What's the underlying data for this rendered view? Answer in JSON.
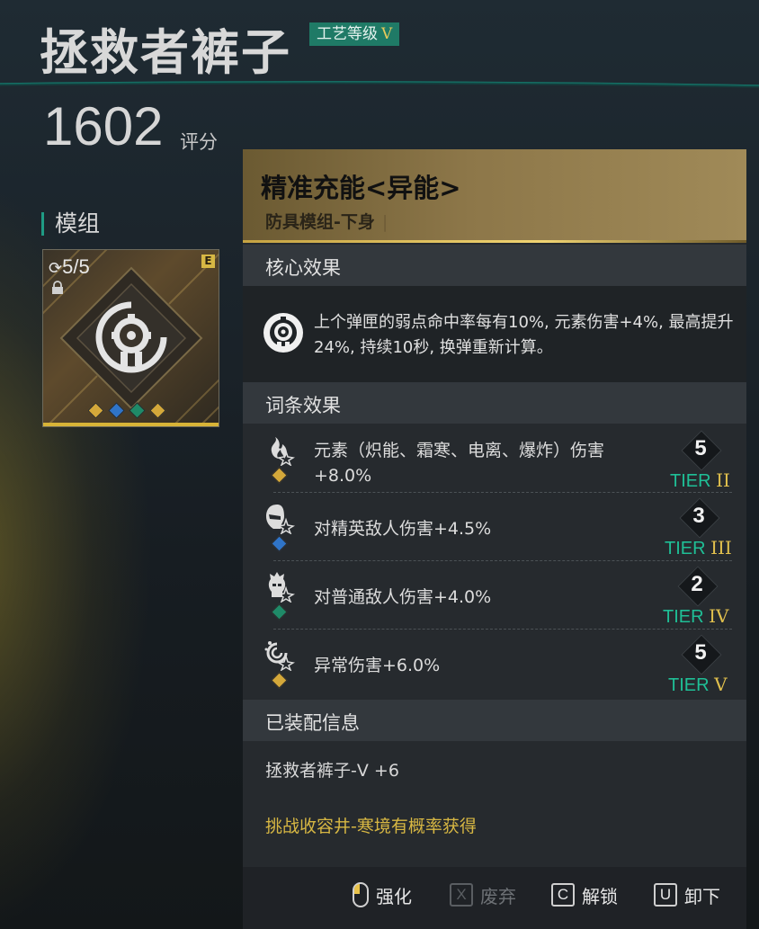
{
  "item": {
    "name": "拯救者裤子",
    "craft_level_label": "工艺等级",
    "craft_level_value": "V",
    "score_value": "1602",
    "score_label": "评分"
  },
  "module": {
    "header": "模组",
    "count": "5/5",
    "grade": "E",
    "gems": [
      "#d4a83a",
      "#2f74c8",
      "#1f8a68",
      "#d4a83a"
    ]
  },
  "panel": {
    "title": "精准充能<异能>",
    "subtitle": "防具模组-下身",
    "core_section": "核心效果",
    "core_text": "上个弹匣的弱点命中率每有10%, 元素伤害+4%, 最高提升24%, 持续10秒, 换弹重新计算。",
    "affix_section": "词条效果",
    "affixes": [
      {
        "text": "元素（炽能、霜寒、电离、爆炸）伤害+8.0%",
        "icon": "flame-burst-icon",
        "gem_color": "#d4a83a",
        "tier_number": "5",
        "tier_prefix": "TIER",
        "tier_roman": "II"
      },
      {
        "text": "对精英敌人伤害+4.5%",
        "icon": "elite-head-icon",
        "gem_color": "#2f74c8",
        "tier_number": "3",
        "tier_prefix": "TIER",
        "tier_roman": "III"
      },
      {
        "text": "对普通敌人伤害+4.0%",
        "icon": "normal-enemy-icon",
        "gem_color": "#1f8a68",
        "tier_number": "2",
        "tier_prefix": "TIER",
        "tier_roman": "IV"
      },
      {
        "text": "异常伤害+6.0%",
        "icon": "anomaly-swirl-icon",
        "gem_color": "#d4a83a",
        "tier_number": "5",
        "tier_prefix": "TIER",
        "tier_roman": "V"
      }
    ],
    "equip_section": "已装配信息",
    "equip_name": "拯救者裤子-V +6",
    "source_text": "挑战收容井-寒境有概率获得"
  },
  "footer": {
    "enhance_label": "强化",
    "discard_key": "X",
    "discard_label": "废弃",
    "unlock_key": "C",
    "unlock_label": "解锁",
    "unequip_key": "U",
    "unequip_label": "卸下"
  },
  "colors": {
    "accent_teal": "#1f9b84",
    "accent_gold": "#d7b743",
    "tier_green": "#1fbf96"
  }
}
